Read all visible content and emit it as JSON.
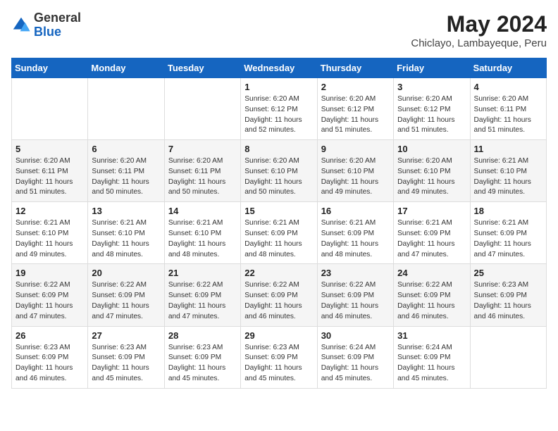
{
  "logo": {
    "general": "General",
    "blue": "Blue"
  },
  "title": {
    "month_year": "May 2024",
    "location": "Chiclayo, Lambayeque, Peru"
  },
  "days_of_week": [
    "Sunday",
    "Monday",
    "Tuesday",
    "Wednesday",
    "Thursday",
    "Friday",
    "Saturday"
  ],
  "weeks": [
    [
      {
        "day": "",
        "info": ""
      },
      {
        "day": "",
        "info": ""
      },
      {
        "day": "",
        "info": ""
      },
      {
        "day": "1",
        "info": "Sunrise: 6:20 AM\nSunset: 6:12 PM\nDaylight: 11 hours\nand 52 minutes."
      },
      {
        "day": "2",
        "info": "Sunrise: 6:20 AM\nSunset: 6:12 PM\nDaylight: 11 hours\nand 51 minutes."
      },
      {
        "day": "3",
        "info": "Sunrise: 6:20 AM\nSunset: 6:12 PM\nDaylight: 11 hours\nand 51 minutes."
      },
      {
        "day": "4",
        "info": "Sunrise: 6:20 AM\nSunset: 6:11 PM\nDaylight: 11 hours\nand 51 minutes."
      }
    ],
    [
      {
        "day": "5",
        "info": "Sunrise: 6:20 AM\nSunset: 6:11 PM\nDaylight: 11 hours\nand 51 minutes."
      },
      {
        "day": "6",
        "info": "Sunrise: 6:20 AM\nSunset: 6:11 PM\nDaylight: 11 hours\nand 50 minutes."
      },
      {
        "day": "7",
        "info": "Sunrise: 6:20 AM\nSunset: 6:11 PM\nDaylight: 11 hours\nand 50 minutes."
      },
      {
        "day": "8",
        "info": "Sunrise: 6:20 AM\nSunset: 6:10 PM\nDaylight: 11 hours\nand 50 minutes."
      },
      {
        "day": "9",
        "info": "Sunrise: 6:20 AM\nSunset: 6:10 PM\nDaylight: 11 hours\nand 49 minutes."
      },
      {
        "day": "10",
        "info": "Sunrise: 6:20 AM\nSunset: 6:10 PM\nDaylight: 11 hours\nand 49 minutes."
      },
      {
        "day": "11",
        "info": "Sunrise: 6:21 AM\nSunset: 6:10 PM\nDaylight: 11 hours\nand 49 minutes."
      }
    ],
    [
      {
        "day": "12",
        "info": "Sunrise: 6:21 AM\nSunset: 6:10 PM\nDaylight: 11 hours\nand 49 minutes."
      },
      {
        "day": "13",
        "info": "Sunrise: 6:21 AM\nSunset: 6:10 PM\nDaylight: 11 hours\nand 48 minutes."
      },
      {
        "day": "14",
        "info": "Sunrise: 6:21 AM\nSunset: 6:10 PM\nDaylight: 11 hours\nand 48 minutes."
      },
      {
        "day": "15",
        "info": "Sunrise: 6:21 AM\nSunset: 6:09 PM\nDaylight: 11 hours\nand 48 minutes."
      },
      {
        "day": "16",
        "info": "Sunrise: 6:21 AM\nSunset: 6:09 PM\nDaylight: 11 hours\nand 48 minutes."
      },
      {
        "day": "17",
        "info": "Sunrise: 6:21 AM\nSunset: 6:09 PM\nDaylight: 11 hours\nand 47 minutes."
      },
      {
        "day": "18",
        "info": "Sunrise: 6:21 AM\nSunset: 6:09 PM\nDaylight: 11 hours\nand 47 minutes."
      }
    ],
    [
      {
        "day": "19",
        "info": "Sunrise: 6:22 AM\nSunset: 6:09 PM\nDaylight: 11 hours\nand 47 minutes."
      },
      {
        "day": "20",
        "info": "Sunrise: 6:22 AM\nSunset: 6:09 PM\nDaylight: 11 hours\nand 47 minutes."
      },
      {
        "day": "21",
        "info": "Sunrise: 6:22 AM\nSunset: 6:09 PM\nDaylight: 11 hours\nand 47 minutes."
      },
      {
        "day": "22",
        "info": "Sunrise: 6:22 AM\nSunset: 6:09 PM\nDaylight: 11 hours\nand 46 minutes."
      },
      {
        "day": "23",
        "info": "Sunrise: 6:22 AM\nSunset: 6:09 PM\nDaylight: 11 hours\nand 46 minutes."
      },
      {
        "day": "24",
        "info": "Sunrise: 6:22 AM\nSunset: 6:09 PM\nDaylight: 11 hours\nand 46 minutes."
      },
      {
        "day": "25",
        "info": "Sunrise: 6:23 AM\nSunset: 6:09 PM\nDaylight: 11 hours\nand 46 minutes."
      }
    ],
    [
      {
        "day": "26",
        "info": "Sunrise: 6:23 AM\nSunset: 6:09 PM\nDaylight: 11 hours\nand 46 minutes."
      },
      {
        "day": "27",
        "info": "Sunrise: 6:23 AM\nSunset: 6:09 PM\nDaylight: 11 hours\nand 45 minutes."
      },
      {
        "day": "28",
        "info": "Sunrise: 6:23 AM\nSunset: 6:09 PM\nDaylight: 11 hours\nand 45 minutes."
      },
      {
        "day": "29",
        "info": "Sunrise: 6:23 AM\nSunset: 6:09 PM\nDaylight: 11 hours\nand 45 minutes."
      },
      {
        "day": "30",
        "info": "Sunrise: 6:24 AM\nSunset: 6:09 PM\nDaylight: 11 hours\nand 45 minutes."
      },
      {
        "day": "31",
        "info": "Sunrise: 6:24 AM\nSunset: 6:09 PM\nDaylight: 11 hours\nand 45 minutes."
      },
      {
        "day": "",
        "info": ""
      }
    ]
  ]
}
